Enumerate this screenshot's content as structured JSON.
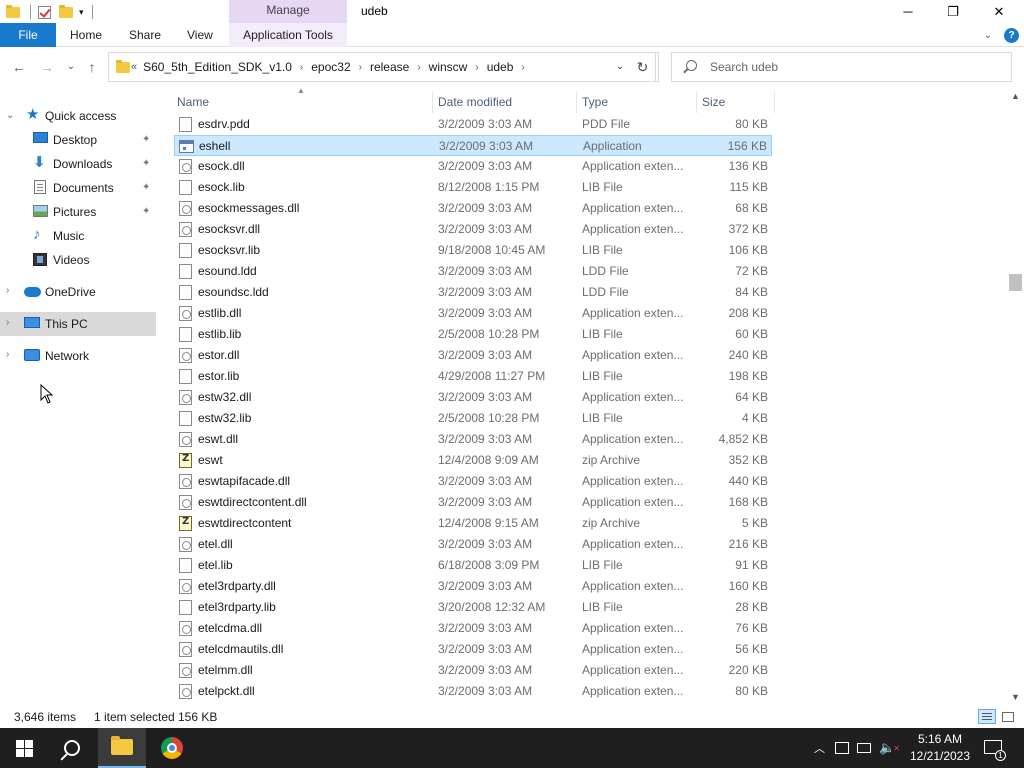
{
  "window": {
    "title": "udeb",
    "contextual_tab": "Manage",
    "controls": {
      "minimize": "─",
      "maximize": "❐",
      "close": "✕"
    }
  },
  "ribbon": {
    "tabs": [
      "File",
      "Home",
      "Share",
      "View",
      "Application Tools"
    ],
    "expand_glyph": "⌄",
    "help_glyph": "?"
  },
  "address": {
    "back": "←",
    "forward": "→",
    "recent": "⌄",
    "up": "↑",
    "overflow": "«",
    "crumbs": [
      "S60_5th_Edition_SDK_v1.0",
      "epoc32",
      "release",
      "winscw",
      "udeb"
    ],
    "crumb_sep": "›",
    "dropdown": "⌄",
    "refresh": "↻"
  },
  "search": {
    "placeholder": "Search udeb"
  },
  "navpane": {
    "items": [
      {
        "label": "Quick access",
        "icon": "star-icon",
        "pinned": false,
        "expandable": true,
        "expanded": true
      },
      {
        "label": "Desktop",
        "icon": "desktop-icon",
        "pinned": true
      },
      {
        "label": "Downloads",
        "icon": "download-icon",
        "pinned": true
      },
      {
        "label": "Documents",
        "icon": "document-icon",
        "pinned": true
      },
      {
        "label": "Pictures",
        "icon": "pictures-icon",
        "pinned": true
      },
      {
        "label": "Music",
        "icon": "music-icon",
        "pinned": false
      },
      {
        "label": "Videos",
        "icon": "video-icon",
        "pinned": false
      },
      {
        "label": "OneDrive",
        "icon": "cloud-icon",
        "expandable": true
      },
      {
        "label": "This PC",
        "icon": "computer-icon",
        "expandable": true,
        "selected": true
      },
      {
        "label": "Network",
        "icon": "network-icon",
        "expandable": true
      }
    ],
    "pin_glyph": "📌"
  },
  "columns": {
    "name": "Name",
    "date": "Date modified",
    "type": "Type",
    "size": "Size"
  },
  "files": [
    {
      "name": "esdrv.pdd",
      "date": "3/2/2009 3:03 AM",
      "type": "PDD File",
      "size": "80 KB",
      "icon": "file"
    },
    {
      "name": "eshell",
      "date": "3/2/2009 3:03 AM",
      "type": "Application",
      "size": "156 KB",
      "icon": "app",
      "selected": true
    },
    {
      "name": "esock.dll",
      "date": "3/2/2009 3:03 AM",
      "type": "Application exten...",
      "size": "136 KB",
      "icon": "dll"
    },
    {
      "name": "esock.lib",
      "date": "8/12/2008 1:15 PM",
      "type": "LIB File",
      "size": "115 KB",
      "icon": "file"
    },
    {
      "name": "esockmessages.dll",
      "date": "3/2/2009 3:03 AM",
      "type": "Application exten...",
      "size": "68 KB",
      "icon": "dll"
    },
    {
      "name": "esocksvr.dll",
      "date": "3/2/2009 3:03 AM",
      "type": "Application exten...",
      "size": "372 KB",
      "icon": "dll"
    },
    {
      "name": "esocksvr.lib",
      "date": "9/18/2008 10:45 AM",
      "type": "LIB File",
      "size": "106 KB",
      "icon": "file"
    },
    {
      "name": "esound.ldd",
      "date": "3/2/2009 3:03 AM",
      "type": "LDD File",
      "size": "72 KB",
      "icon": "file"
    },
    {
      "name": "esoundsc.ldd",
      "date": "3/2/2009 3:03 AM",
      "type": "LDD File",
      "size": "84 KB",
      "icon": "file"
    },
    {
      "name": "estlib.dll",
      "date": "3/2/2009 3:03 AM",
      "type": "Application exten...",
      "size": "208 KB",
      "icon": "dll"
    },
    {
      "name": "estlib.lib",
      "date": "2/5/2008 10:28 PM",
      "type": "LIB File",
      "size": "60 KB",
      "icon": "file"
    },
    {
      "name": "estor.dll",
      "date": "3/2/2009 3:03 AM",
      "type": "Application exten...",
      "size": "240 KB",
      "icon": "dll"
    },
    {
      "name": "estor.lib",
      "date": "4/29/2008 11:27 PM",
      "type": "LIB File",
      "size": "198 KB",
      "icon": "file"
    },
    {
      "name": "estw32.dll",
      "date": "3/2/2009 3:03 AM",
      "type": "Application exten...",
      "size": "64 KB",
      "icon": "dll"
    },
    {
      "name": "estw32.lib",
      "date": "2/5/2008 10:28 PM",
      "type": "LIB File",
      "size": "4 KB",
      "icon": "file"
    },
    {
      "name": "eswt.dll",
      "date": "3/2/2009 3:03 AM",
      "type": "Application exten...",
      "size": "4,852 KB",
      "icon": "dll"
    },
    {
      "name": "eswt",
      "date": "12/4/2008 9:09 AM",
      "type": "zip Archive",
      "size": "352 KB",
      "icon": "zip"
    },
    {
      "name": "eswtapifacade.dll",
      "date": "3/2/2009 3:03 AM",
      "type": "Application exten...",
      "size": "440 KB",
      "icon": "dll"
    },
    {
      "name": "eswtdirectcontent.dll",
      "date": "3/2/2009 3:03 AM",
      "type": "Application exten...",
      "size": "168 KB",
      "icon": "dll"
    },
    {
      "name": "eswtdirectcontent",
      "date": "12/4/2008 9:15 AM",
      "type": "zip Archive",
      "size": "5 KB",
      "icon": "zip"
    },
    {
      "name": "etel.dll",
      "date": "3/2/2009 3:03 AM",
      "type": "Application exten...",
      "size": "216 KB",
      "icon": "dll"
    },
    {
      "name": "etel.lib",
      "date": "6/18/2008 3:09 PM",
      "type": "LIB File",
      "size": "91 KB",
      "icon": "file"
    },
    {
      "name": "etel3rdparty.dll",
      "date": "3/2/2009 3:03 AM",
      "type": "Application exten...",
      "size": "160 KB",
      "icon": "dll"
    },
    {
      "name": "etel3rdparty.lib",
      "date": "3/20/2008 12:32 AM",
      "type": "LIB File",
      "size": "28 KB",
      "icon": "file"
    },
    {
      "name": "etelcdma.dll",
      "date": "3/2/2009 3:03 AM",
      "type": "Application exten...",
      "size": "76 KB",
      "icon": "dll"
    },
    {
      "name": "etelcdmautils.dll",
      "date": "3/2/2009 3:03 AM",
      "type": "Application exten...",
      "size": "56 KB",
      "icon": "dll"
    },
    {
      "name": "etelmm.dll",
      "date": "3/2/2009 3:03 AM",
      "type": "Application exten...",
      "size": "220 KB",
      "icon": "dll"
    },
    {
      "name": "etelpckt.dll",
      "date": "3/2/2009 3:03 AM",
      "type": "Application exten...",
      "size": "80 KB",
      "icon": "dll"
    }
  ],
  "status": {
    "items": "3,646 items",
    "selected": "1 item selected",
    "selected_size": "156 KB"
  },
  "scrollbar": {
    "up": "▲",
    "down": "▼"
  },
  "taskbar": {
    "clock_time": "5:16 AM",
    "clock_date": "12/21/2023",
    "tray_glyphs": {
      "chevron": "︿",
      "speaker": "🔈",
      "mute": "✕"
    },
    "notifications": "1"
  },
  "colors": {
    "accent": "#1979ca",
    "selection": "#cce8ff",
    "manage": "#e6d7f5",
    "taskbar": "#1f1f1f"
  }
}
